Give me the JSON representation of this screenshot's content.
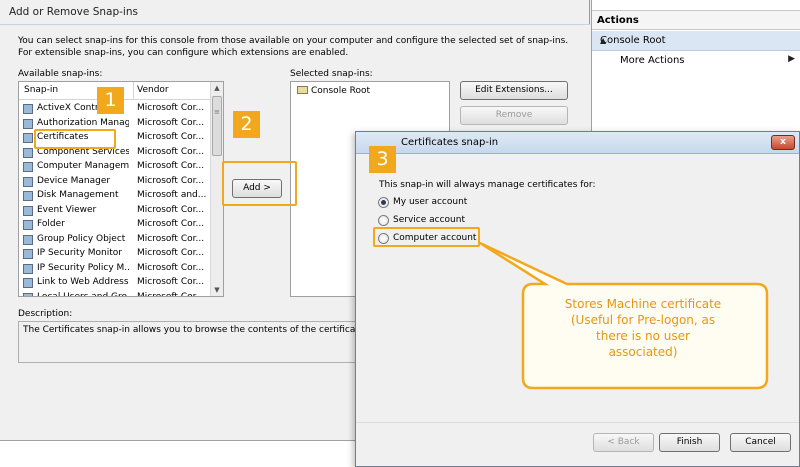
{
  "main_dialog": {
    "title": "Add or Remove Snap-ins",
    "intro": "You can select snap-ins for this console from those available on your computer and configure the selected set of snap-ins. For extensible snap-ins, you can configure which extensions are enabled.",
    "available_label": "Available snap-ins:",
    "selected_label": "Selected snap-ins:",
    "columns": {
      "snapin": "Snap-in",
      "vendor": "Vendor"
    },
    "snapins": [
      {
        "name": "ActiveX Control",
        "vendor": "Microsoft Cor..."
      },
      {
        "name": "Authorization Manager",
        "vendor": "Microsoft Cor..."
      },
      {
        "name": "Certificates",
        "vendor": "Microsoft Cor..."
      },
      {
        "name": "Component Services",
        "vendor": "Microsoft Cor..."
      },
      {
        "name": "Computer Managem...",
        "vendor": "Microsoft Cor..."
      },
      {
        "name": "Device Manager",
        "vendor": "Microsoft Cor..."
      },
      {
        "name": "Disk Management",
        "vendor": "Microsoft and..."
      },
      {
        "name": "Event Viewer",
        "vendor": "Microsoft Cor..."
      },
      {
        "name": "Folder",
        "vendor": "Microsoft Cor..."
      },
      {
        "name": "Group Policy Object ...",
        "vendor": "Microsoft Cor..."
      },
      {
        "name": "IP Security Monitor",
        "vendor": "Microsoft Cor..."
      },
      {
        "name": "IP Security Policy M...",
        "vendor": "Microsoft Cor..."
      },
      {
        "name": "Link to Web Address",
        "vendor": "Microsoft Cor..."
      },
      {
        "name": "Local Users and Gro...",
        "vendor": "Microsoft Cor..."
      }
    ],
    "selected_snapins": [
      "Console Root"
    ],
    "add_button": "Add >",
    "edit_extensions_button": "Edit Extensions...",
    "remove_button": "Remove",
    "description_label": "Description:",
    "description_text": "The Certificates snap-in allows you to browse the contents of the certificate stores"
  },
  "actions_pane": {
    "title": "Actions",
    "section": "Console Root",
    "more_actions": "More Actions"
  },
  "cert_dialog": {
    "title": "Certificates snap-in",
    "intro": "This snap-in will always manage certificates for:",
    "options": [
      {
        "label": "My user account",
        "selected": true
      },
      {
        "label": "Service account",
        "selected": false
      },
      {
        "label": "Computer account",
        "selected": false
      }
    ],
    "back_button": "< Back",
    "finish_button": "Finish",
    "cancel_button": "Cancel",
    "close_glyph": "x"
  },
  "annotations": {
    "step1": "1",
    "step2": "2",
    "step3": "3",
    "callout_lines": [
      "Stores Machine certificate",
      "(Useful for Pre-logon, as",
      "there is no user",
      "associated)"
    ],
    "accent_color": "#f2a81d"
  }
}
